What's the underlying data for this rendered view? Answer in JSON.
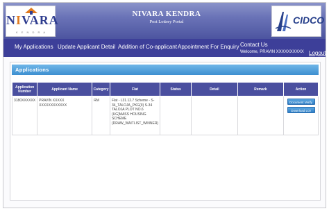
{
  "header": {
    "left_logo": {
      "wordmark_n": "N",
      "wordmark_i": "I",
      "wordmark_rest": "VARA",
      "sub": "K E N D R A"
    },
    "title": "NIVARA KENDRA",
    "subtitle": "Post Lottery Portal",
    "right_logo": {
      "name": "CIDCO",
      "tagline": "WE MAKE CITIES"
    }
  },
  "nav": {
    "items": [
      {
        "label": "My Applications"
      },
      {
        "label": "Update Applicant Detail"
      },
      {
        "label": "Addition of Co-applicant"
      },
      {
        "label": "Appointment For Enquiry"
      },
      {
        "label": "Contact Us"
      }
    ],
    "welcome": "Welcome,  PRAVIN XXXXXXXXXX",
    "logout": "Logout"
  },
  "panel": {
    "title": "Applications",
    "columns": [
      "Application Number",
      "Applicant Name",
      "Category",
      "Flat",
      "Status",
      "Detail",
      "Remark",
      "Action"
    ],
    "rows": [
      {
        "application_number": "3180XXXXXX",
        "applicant_name": "PRAVIN XXXXX XXXXXXXXXXXX",
        "category": "RM",
        "flat": "Flat - L31.12.7 Scheme - S-34_TALOJA_PKG(II) S-34 TALOJA PLOT NO.6 (UG)MASS HOUSING SCHEME (DRAW_WAITLIST_WINNER)",
        "status": "",
        "detail": "",
        "remark": "",
        "actions": [
          "Document Verify",
          "Download LOI"
        ]
      }
    ]
  },
  "colors": {
    "header_gradient_top": "#8a93c9",
    "nav_bg": "#3d3f99",
    "panel_head": "#3d8fd0",
    "table_head": "#4a4f9f",
    "button": "#2f7fc6"
  }
}
